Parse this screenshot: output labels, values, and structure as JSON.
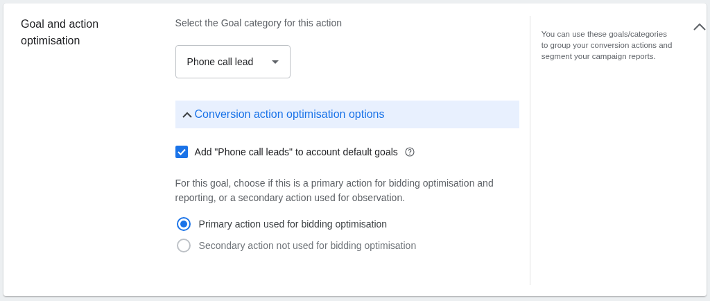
{
  "section_title": "Goal and action optimisation",
  "prompt": "Select the Goal category for this action",
  "dropdown": {
    "value": "Phone call lead"
  },
  "optimisation_panel": {
    "title": "Conversion action optimisation options",
    "expanded": true
  },
  "default_goals_checkbox": {
    "label": "Add \"Phone call leads\" to account default goals",
    "checked": true
  },
  "description": "For this goal, choose if this is a primary action for bidding optimisation and reporting, or a secondary action used for observation.",
  "radio_options": [
    {
      "label": "Primary action used for bidding optimisation",
      "selected": true
    },
    {
      "label": "Secondary action not used for bidding optimisation",
      "selected": false
    }
  ],
  "help_text": "You can use these goals/categories to group your conversion actions and segment your campaign reports.",
  "section_expanded": true
}
